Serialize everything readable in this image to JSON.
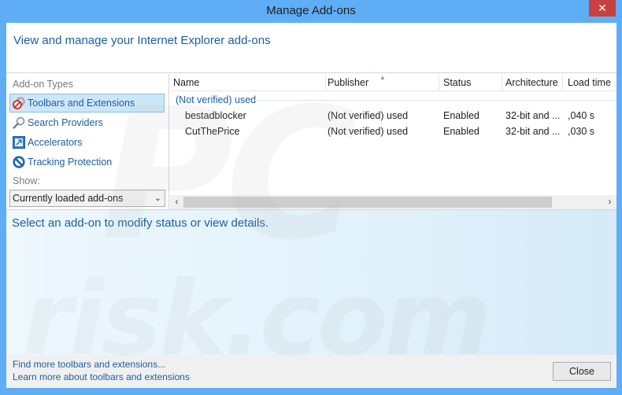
{
  "window": {
    "title": "Manage Add-ons",
    "close_glyph": "✕"
  },
  "header": {
    "text": "View and manage your Internet Explorer add-ons"
  },
  "sidebar": {
    "types_label": "Add-on Types",
    "items": [
      {
        "label": "Toolbars and Extensions",
        "icon": "gear-block-icon",
        "selected": true
      },
      {
        "label": "Search Providers",
        "icon": "magnifier-icon",
        "selected": false
      },
      {
        "label": "Accelerators",
        "icon": "accelerator-arrow-icon",
        "selected": false
      },
      {
        "label": "Tracking Protection",
        "icon": "no-entry-icon",
        "selected": false
      }
    ],
    "show_label": "Show:",
    "show_value": "Currently loaded add-ons"
  },
  "list": {
    "columns": [
      "Name",
      "Publisher",
      "Status",
      "Architecture",
      "Load time"
    ],
    "sorted_column": "Publisher",
    "group": "(Not verified) used",
    "rows": [
      {
        "name": "bestadblocker",
        "publisher": "(Not verified) used",
        "status": "Enabled",
        "architecture": "32-bit and ...",
        "load_time": ",040 s"
      },
      {
        "name": "CutThePrice",
        "publisher": "(Not verified) used",
        "status": "Enabled",
        "architecture": "32-bit and ...",
        "load_time": ",030 s"
      }
    ],
    "scroll_left": "‹",
    "scroll_right": "›"
  },
  "details": {
    "text": "Select an add-on to modify status or view details."
  },
  "footer": {
    "link1": "Find more toolbars and extensions...",
    "link2": "Learn more about toolbars and extensions",
    "close_label": "Close"
  },
  "watermark": {
    "line1": "PC",
    "line2": "risk.com"
  }
}
